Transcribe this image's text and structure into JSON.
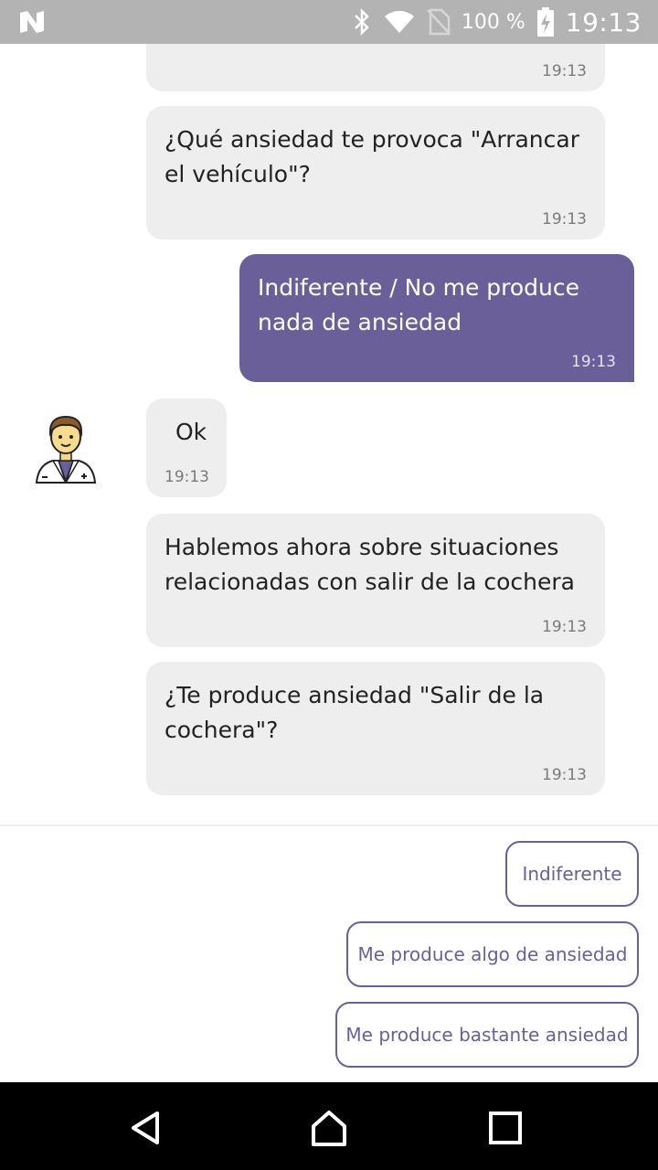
{
  "status_bar": {
    "battery_percent": "100 %",
    "time": "19:13"
  },
  "messages": [
    {
      "from": "bot",
      "text": "",
      "time": "19:13"
    },
    {
      "from": "bot",
      "text": "¿Qué ansiedad te provoca \"Arrancar el vehículo\"?",
      "time": "19:13"
    },
    {
      "from": "user",
      "text": "Indiferente / No me produce nada de ansiedad",
      "time": "19:13"
    },
    {
      "from": "bot",
      "text": "Ok",
      "time": "19:13"
    },
    {
      "from": "bot",
      "text": "Hablemos ahora sobre situaciones relacionadas con salir de la cochera",
      "time": "19:13"
    },
    {
      "from": "bot",
      "text": "¿Te produce ansiedad \"Salir de la cochera\"?",
      "time": "19:13"
    }
  ],
  "quick_replies": [
    "Indiferente",
    "Me produce algo de ansiedad",
    "Me produce bastante ansiedad"
  ],
  "icons": {
    "status": [
      "n-logo-icon",
      "bluetooth-icon",
      "wifi-icon",
      "no-sim-icon",
      "battery-charging-icon"
    ],
    "nav": [
      "back-icon",
      "home-icon",
      "recents-icon"
    ],
    "avatar": "doctor-avatar"
  },
  "colors": {
    "accent": "#6a5f99",
    "bot_bubble": "#eeeeee",
    "status_bar": "#b3b3b3",
    "nav_bar": "#000000"
  }
}
